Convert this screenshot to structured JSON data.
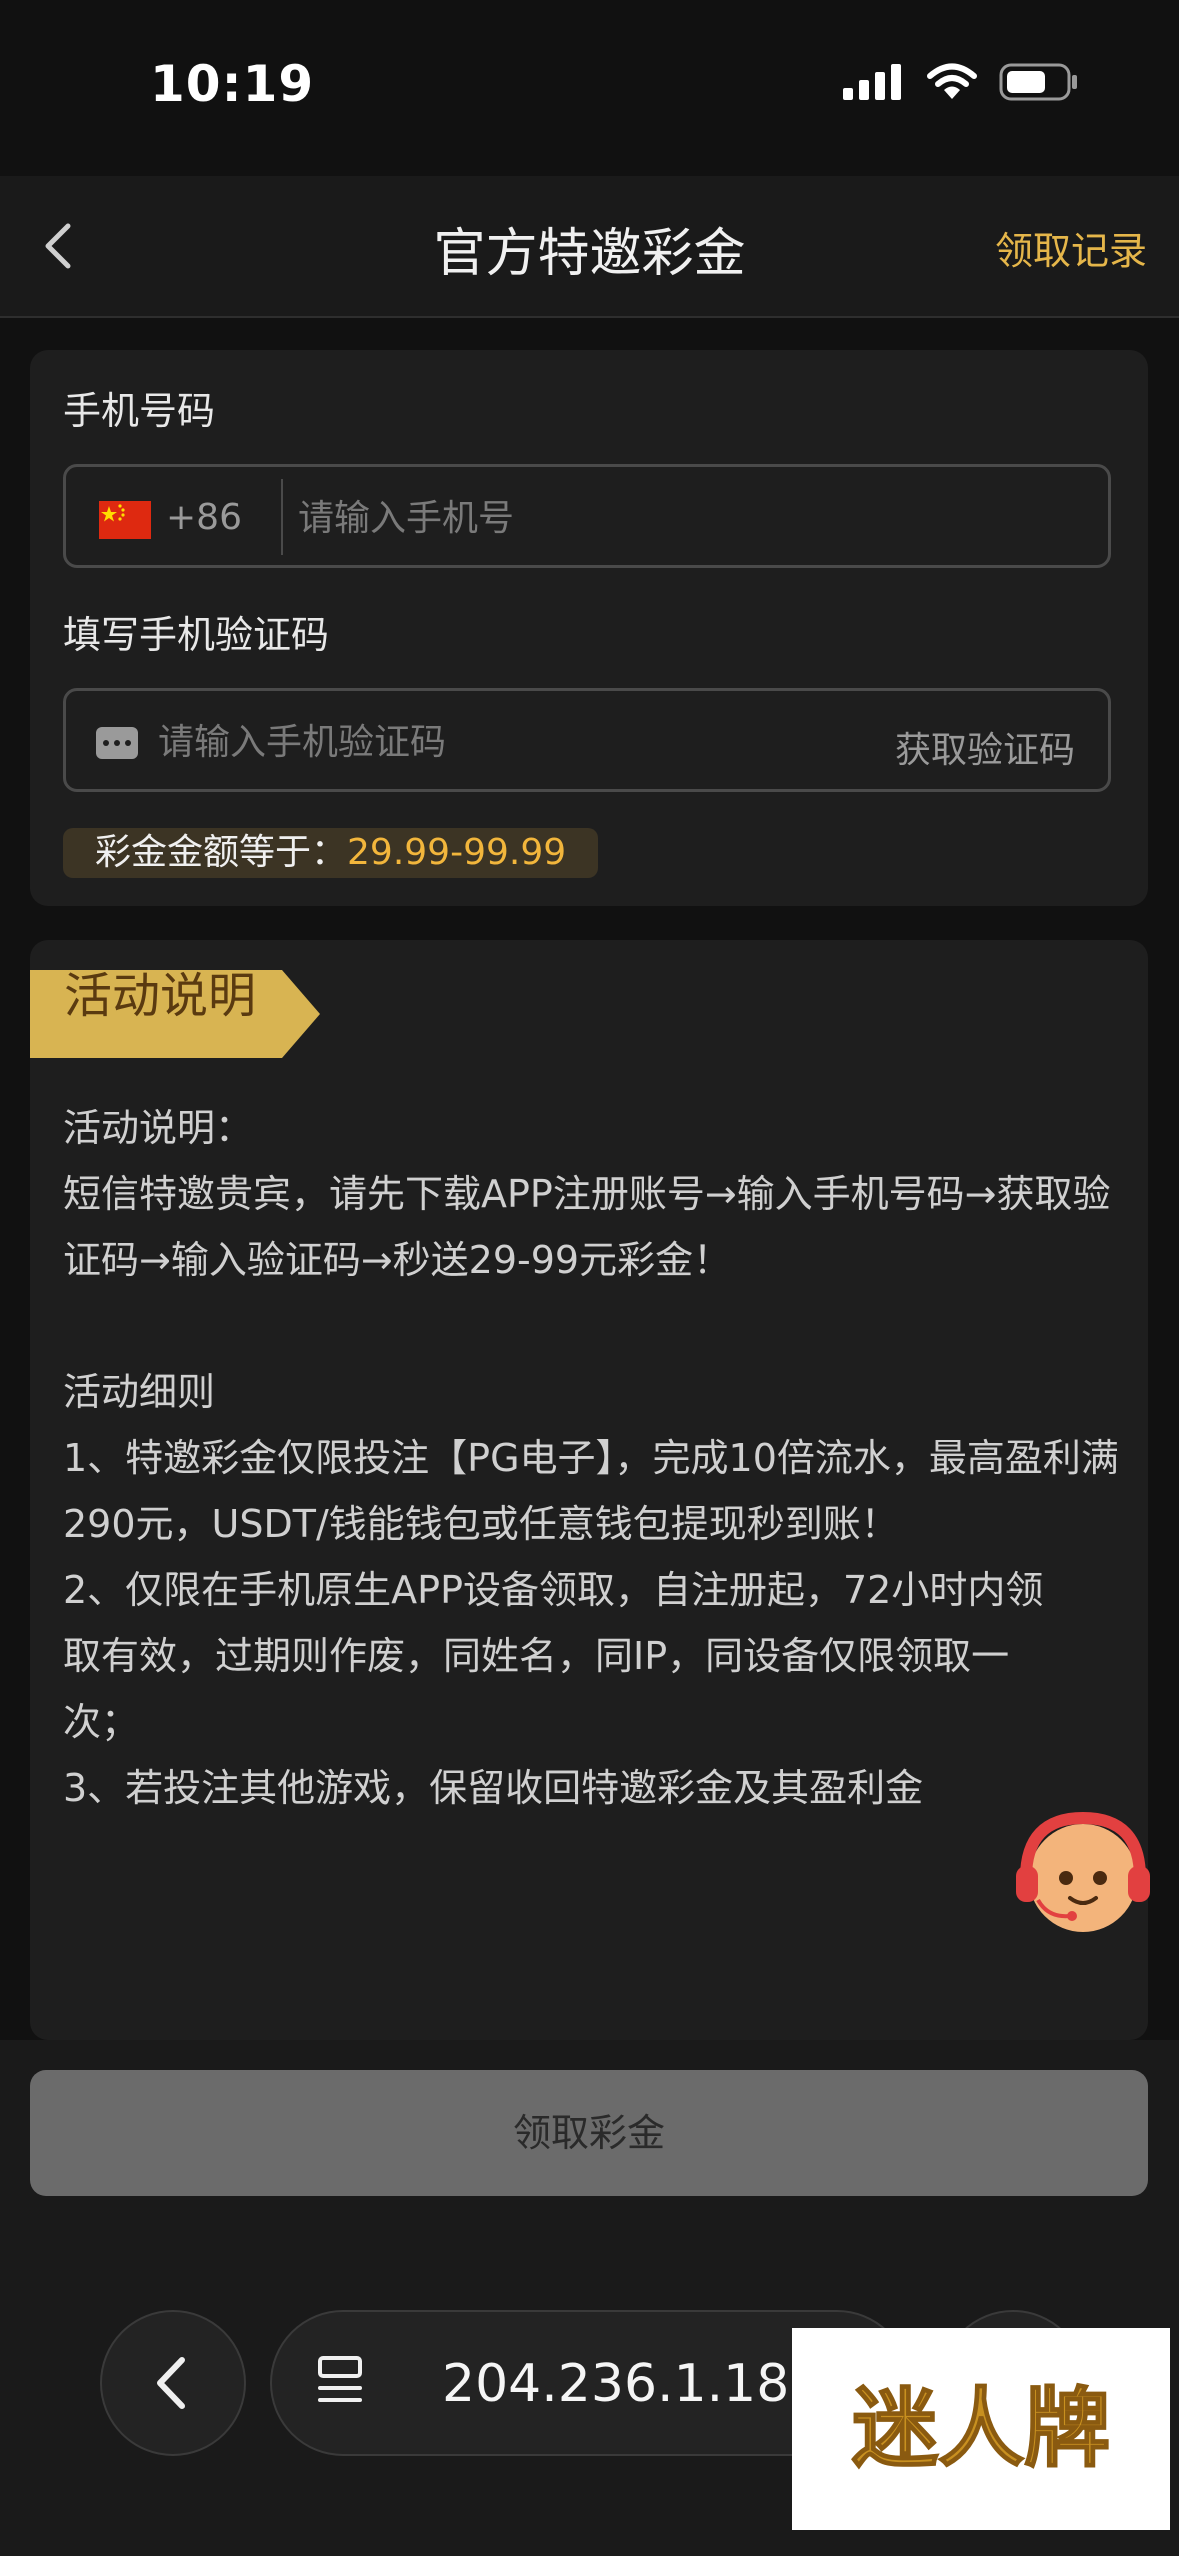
{
  "status_bar": {
    "time": "10:19"
  },
  "nav": {
    "title": "官方特邀彩金",
    "record_link": "领取记录"
  },
  "form": {
    "phone_label": "手机号码",
    "country_code": "+86",
    "phone_placeholder": "请输入手机号",
    "code_label": "填写手机验证码",
    "code_placeholder": "请输入手机验证码",
    "get_code_label": "获取验证码",
    "amount_label": "彩金金额等于：",
    "amount_value": "29.99-99.99"
  },
  "description": {
    "ribbon_title": "活动说明",
    "body": "活动说明：\n短信特邀贵宾，请先下载APP注册账号→输入手机号码→获取验证码→输入验证码→秒送29-99元彩金！\n\n活动细则\n1、特邀彩金仅限投注【PG电子】，完成10倍流水，最高盈利满290元，USDT/钱能钱包或任意钱包提现秒到账！\n2、仅限在手机原生APP设备领取，自注册起，72小时内领\n取有效，过期则作废，同姓名，同IP，同设备仅限领取一\n次；\n3、若投注其他游戏，保留收回特邀彩金及其盈利金"
  },
  "claim_button": {
    "label": "领取彩金"
  },
  "browser": {
    "address": "204.236.1.18"
  },
  "watermark": {
    "text": "迷人牌"
  },
  "colors": {
    "accent": "#e5b64a",
    "amount": "#f2b63c",
    "ribbon": "#d8b452",
    "button": "#6b6b6b"
  }
}
